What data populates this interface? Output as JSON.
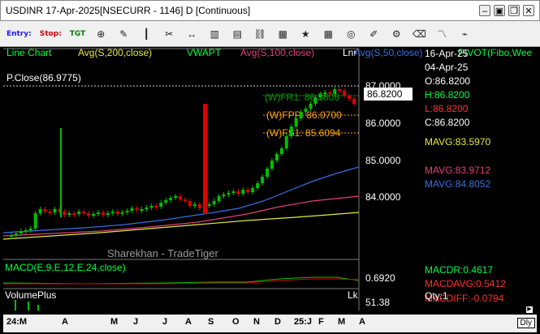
{
  "window": {
    "title": "USDINR 17-Apr-2025[NSECURR - 1146] D [Continuous]"
  },
  "toolbar": {
    "entry_label": "Entry:",
    "stop_label": "Stop:",
    "tgt_label": "TGT"
  },
  "legend": {
    "line_chart": "Line Chart",
    "avg200": "Avg(S,200,close)",
    "vwapt": "VWAPT",
    "avg100": "Avg(S,100,close)",
    "lnr": "Lnr",
    "avg50": "Avg(S,50,close)",
    "pivot": "PIVOT(Fibo,Wee"
  },
  "chart": {
    "pclose": "P.Close(86.9775)",
    "fr1": "(W)FR1: 86.5806",
    "fpp": "(W)FPP: 86.0700",
    "fs1": "(W)FS1: 85.6094",
    "watermark": "Sharekhan - TradeTiger",
    "price_tag": "86.8200",
    "y_labels": [
      "87.0000",
      "86.0000",
      "85.0000",
      "84.0000"
    ],
    "macd_label": "MACD(E,9,E,12,E,24,close)",
    "macd_value": "0.6920",
    "volume_label": "VolumePlus",
    "lk": "Lk",
    "vol_value": "51.38"
  },
  "panel": {
    "date1": "16-Apr-25",
    "date2": "04-Apr-25",
    "open": "O:86.8200",
    "high": "H:86.8200",
    "low": "L:86.8200",
    "close": "C:86.8200",
    "mavg1": "MAVG:83.5970",
    "mavg2": "MAVG:83.9712",
    "mavg3": "MAVG:84.8052",
    "macdr": "MACDR:0.4617",
    "macdavg": "MACDAVG:0.5412",
    "macdiff": "MACDIFF:-0.0794",
    "qty": "Qty:1"
  },
  "xaxis": {
    "labels": [
      "24:M",
      "A",
      "M",
      "J",
      "J",
      "A",
      "S",
      "O",
      "N",
      "D",
      "25:J",
      "F",
      "M",
      "A"
    ]
  },
  "footer": {
    "dly": "Dly"
  },
  "colors": {
    "avg200": "#e8e840",
    "avg100": "#e0407a",
    "avg50": "#3a6fe0",
    "up": "#00c000",
    "down": "#e00000",
    "pivot": "#ffa500"
  }
}
